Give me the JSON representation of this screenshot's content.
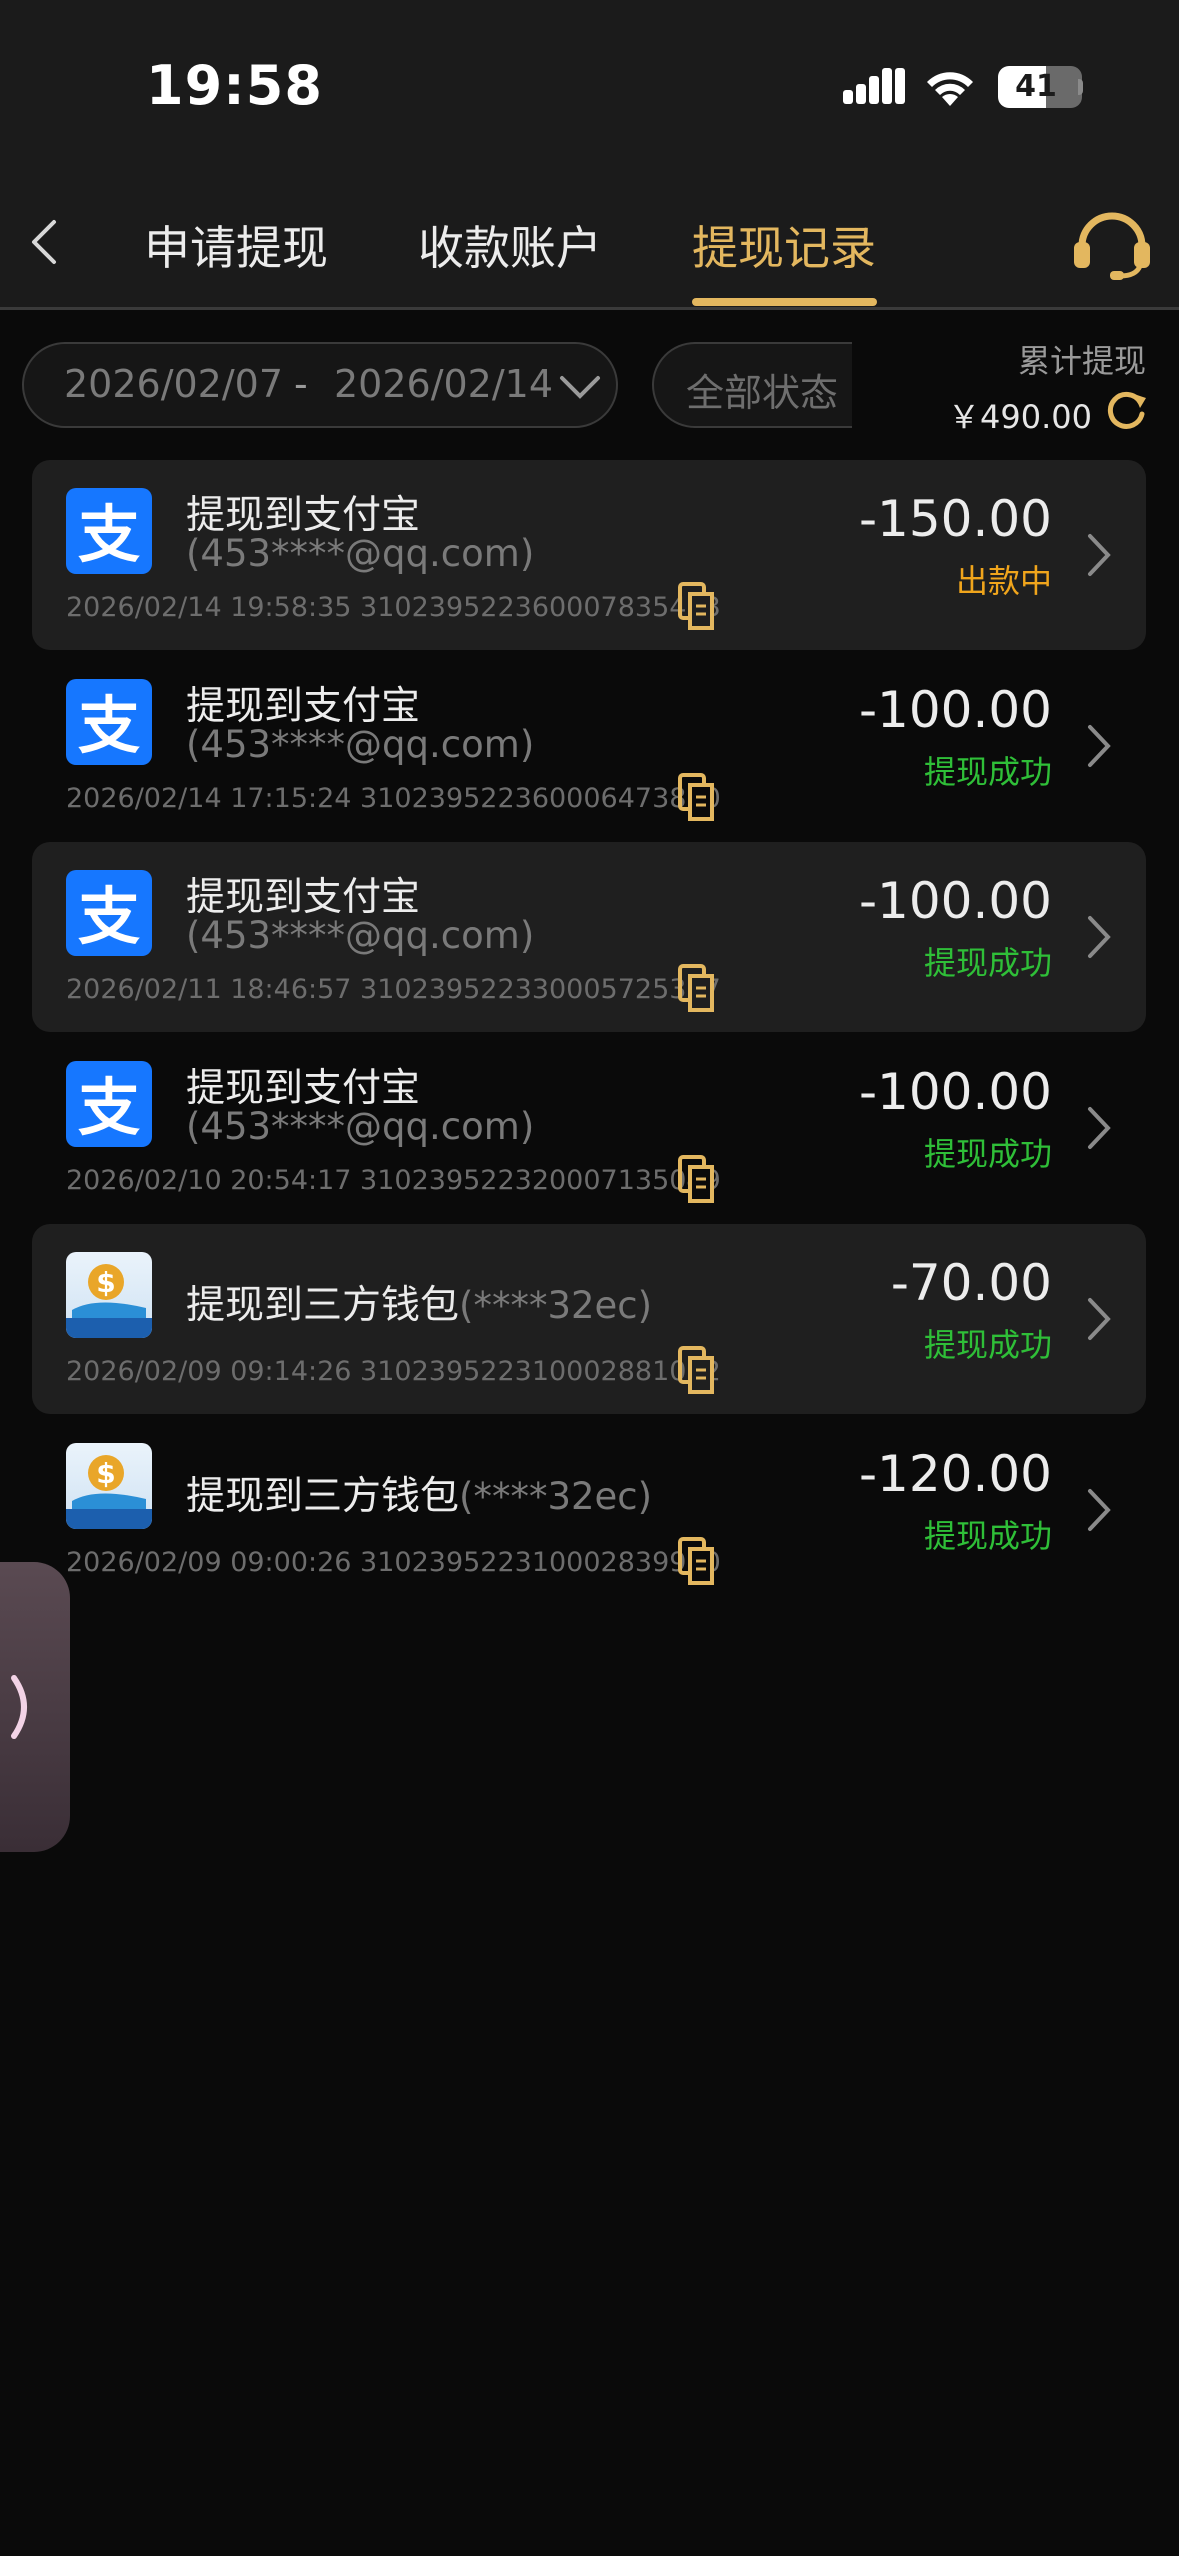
{
  "status_bar": {
    "time": "19:58",
    "battery": "41"
  },
  "nav": {
    "tabs": [
      {
        "label": "申请提现",
        "active": false
      },
      {
        "label": "收款账户",
        "active": false
      },
      {
        "label": "提现记录",
        "active": true
      }
    ],
    "accent_color": "#e3b75f"
  },
  "filters": {
    "date_start": "2026/02/07",
    "date_separator": "-",
    "date_end": "2026/02/14",
    "status_filter": "全部状态",
    "cumulative_label": "累计提现",
    "cumulative_value": "￥490.00"
  },
  "records": [
    {
      "icon": "alipay-icon",
      "title": "提现到支付宝",
      "account": "(453****@qq.com)",
      "meta": "2026/02/14 19:58:35 310239522360007835423",
      "amount": "-150.00",
      "status": "出款中",
      "status_color": "#f0a51c"
    },
    {
      "icon": "alipay-icon",
      "title": "提现到支付宝",
      "account": "(453****@qq.com)",
      "meta": "2026/02/14 17:15:24 310239522360006473870",
      "amount": "-100.00",
      "status": "提现成功",
      "status_color": "#2fbf38"
    },
    {
      "icon": "alipay-icon",
      "title": "提现到支付宝",
      "account": "(453****@qq.com)",
      "meta": "2026/02/11 18:46:57 310239522330005725337",
      "amount": "-100.00",
      "status": "提现成功",
      "status_color": "#2fbf38"
    },
    {
      "icon": "alipay-icon",
      "title": "提现到支付宝",
      "account": "(453****@qq.com)",
      "meta": "2026/02/10 20:54:17 310239522320007135049",
      "amount": "-100.00",
      "status": "提现成功",
      "status_color": "#2fbf38"
    },
    {
      "icon": "wallet-icon",
      "title": "提现到三方钱包",
      "account": "(****32ec)",
      "meta": "2026/02/09 09:14:26 310239522310002881002",
      "amount": "-70.00",
      "status": "提现成功",
      "status_color": "#2fbf38"
    },
    {
      "icon": "wallet-icon",
      "title": "提现到三方钱包",
      "account": "(****32ec)",
      "meta": "2026/02/09 09:00:26 310239522310002839950",
      "amount": "-120.00",
      "status": "提现成功",
      "status_color": "#2fbf38"
    }
  ]
}
